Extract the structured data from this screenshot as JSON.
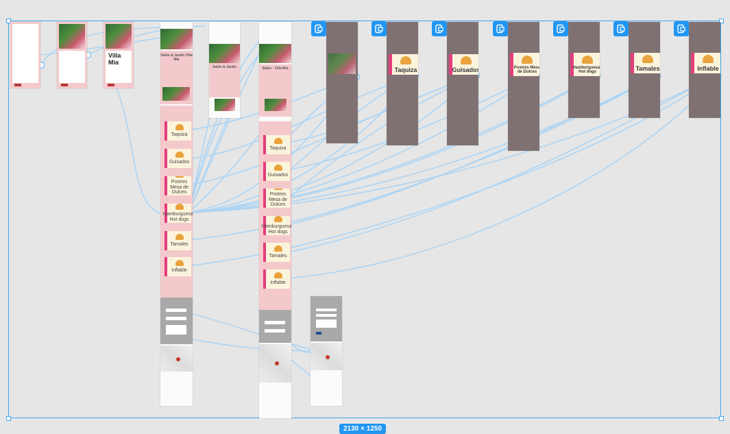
{
  "canvas": {
    "size_label": "2130 × 1250",
    "accent": "#2196f3",
    "wire_color": "#a9d4f5"
  },
  "frames": {
    "villa": {
      "title_line1": "Villa",
      "title_line2": "Mia"
    },
    "hero": {
      "title": "Salón & Jardín Villa Mía"
    },
    "hero2": {
      "title": "Salón & Jardín"
    },
    "hero3": {
      "title": "Salón - Villa Mía"
    }
  },
  "cards": [
    {
      "label": "Taquiza"
    },
    {
      "label": "Guisados"
    },
    {
      "label": "Postres Mesa de Dulces"
    },
    {
      "label": "Hamburguesas Hot dogs"
    },
    {
      "label": "Tamales"
    },
    {
      "label": "Inflable"
    }
  ],
  "overlays": [
    {
      "label": ""
    },
    {
      "label": "Taquiza"
    },
    {
      "label": "Guisados"
    },
    {
      "label": "Postres Mesa de Dulces"
    },
    {
      "label": "Hamburguesas Hot dogs"
    },
    {
      "label": "Tamales"
    },
    {
      "label": "Inflable"
    }
  ],
  "icons": {
    "prototype_link": "device-link-icon"
  }
}
